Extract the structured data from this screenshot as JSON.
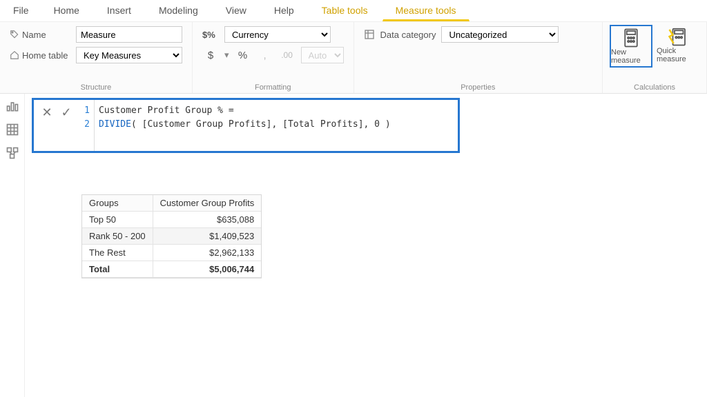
{
  "menu": {
    "tabs": [
      "File",
      "Home",
      "Insert",
      "Modeling",
      "View",
      "Help",
      "Table tools",
      "Measure tools"
    ],
    "active": "Measure tools"
  },
  "ribbon": {
    "structure": {
      "group_label": "Structure",
      "name_label": "Name",
      "name_value": "Measure",
      "home_label": "Home table",
      "home_value": "Key Measures"
    },
    "formatting": {
      "group_label": "Formatting",
      "format_value": "Currency",
      "currency_symbol": "$",
      "percent": "%",
      "comma": ",",
      "decimals": ".00",
      "auto": "Auto"
    },
    "properties": {
      "group_label": "Properties",
      "data_cat_label": "Data category",
      "data_cat_value": "Uncategorized"
    },
    "calculations": {
      "group_label": "Calculations",
      "new_measure": "New measure",
      "quick_measure": "Quick measure"
    }
  },
  "formula": {
    "line_numbers": [
      "1",
      "2"
    ],
    "line1_name": "Customer Profit Group % =",
    "line2_func": "DIVIDE",
    "line2_args": "[Customer Group Profits], [Total Profits], 0"
  },
  "table": {
    "headers": [
      "Groups",
      "Customer Group Profits"
    ],
    "rows": [
      {
        "g": "Top 50",
        "v": "$635,088"
      },
      {
        "g": "Rank 50 - 200",
        "v": "$1,409,523"
      },
      {
        "g": "The Rest",
        "v": "$2,962,133"
      }
    ],
    "total_label": "Total",
    "total_value": "$5,006,744"
  }
}
